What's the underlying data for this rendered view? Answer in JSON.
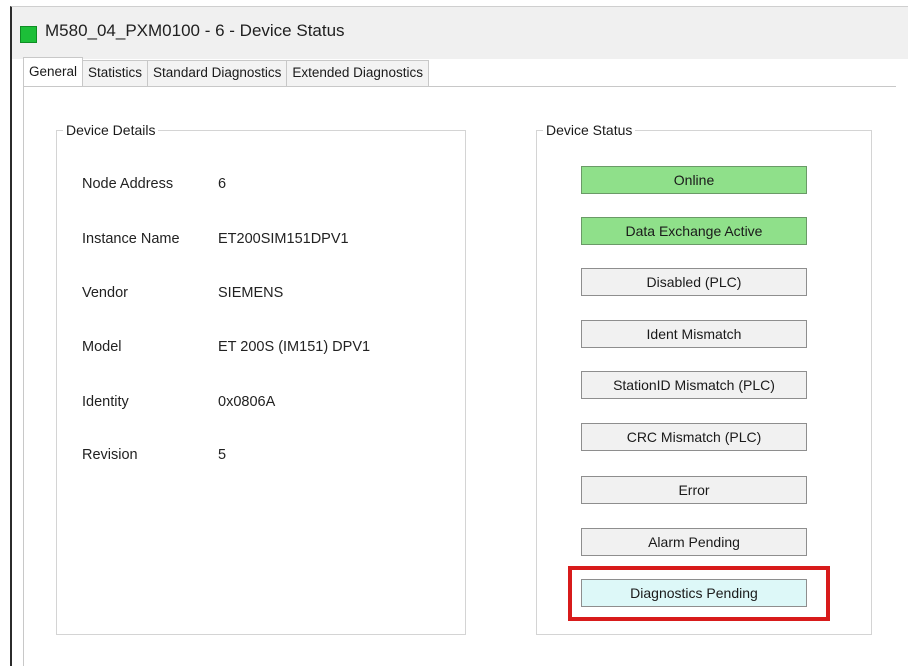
{
  "window": {
    "title": "M580_04_PXM0100 - 6 - Device Status",
    "status_color": "#1cbf38"
  },
  "tabs": [
    {
      "label": "General",
      "active": true
    },
    {
      "label": "Statistics",
      "active": false
    },
    {
      "label": "Standard Diagnostics",
      "active": false
    },
    {
      "label": "Extended Diagnostics",
      "active": false
    }
  ],
  "device_details": {
    "legend": "Device Details",
    "rows": [
      {
        "label": "Node Address",
        "value": "6"
      },
      {
        "label": "Instance Name",
        "value": "ET200SIM151DPV1"
      },
      {
        "label": "Vendor",
        "value": "SIEMENS"
      },
      {
        "label": "Model",
        "value": "ET 200S (IM151) DPV1"
      },
      {
        "label": "Identity",
        "value": "0x0806A"
      },
      {
        "label": "Revision",
        "value": "5"
      }
    ]
  },
  "device_status": {
    "legend": "Device Status",
    "indicators": [
      {
        "label": "Online",
        "state": "active",
        "color": "#8fe08a"
      },
      {
        "label": "Data Exchange Active",
        "state": "active",
        "color": "#8fe08a"
      },
      {
        "label": "Disabled (PLC)",
        "state": "inactive",
        "color": "#f1f1f1"
      },
      {
        "label": "Ident Mismatch",
        "state": "inactive",
        "color": "#f1f1f1"
      },
      {
        "label": "StationID Mismatch (PLC)",
        "state": "inactive",
        "color": "#f1f1f1"
      },
      {
        "label": "CRC Mismatch (PLC)",
        "state": "inactive",
        "color": "#f1f1f1"
      },
      {
        "label": "Error",
        "state": "inactive",
        "color": "#f1f1f1"
      },
      {
        "label": "Alarm Pending",
        "state": "inactive",
        "color": "#f1f1f1"
      },
      {
        "label": "Diagnostics Pending",
        "state": "active",
        "color": "#ddf8f8",
        "highlighted": true
      }
    ],
    "highlight_color": "#d81b1b"
  }
}
